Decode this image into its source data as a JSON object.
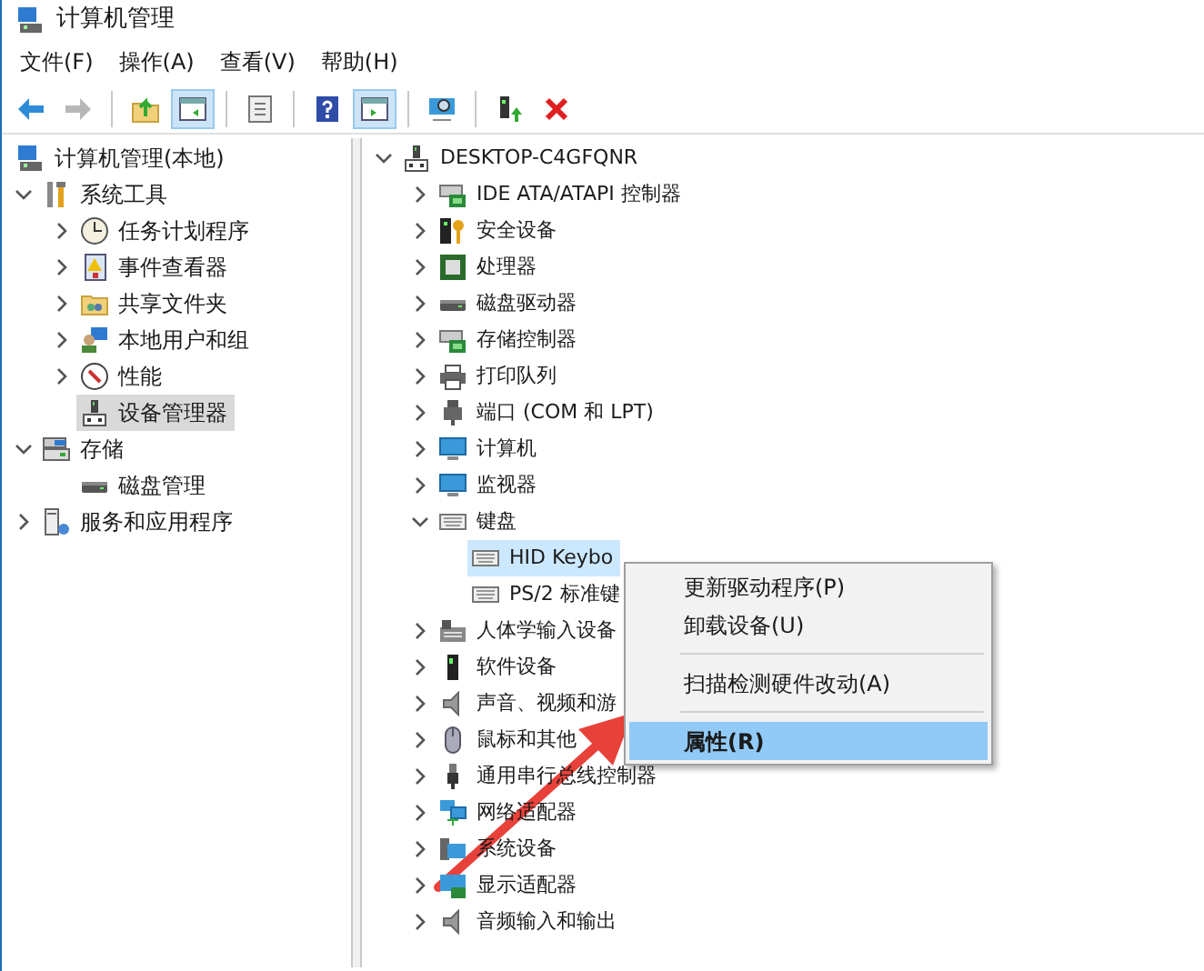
{
  "window": {
    "title": "计算机管理"
  },
  "menu_bar": [
    "文件(F)",
    "操作(A)",
    "查看(V)",
    "帮助(H)"
  ],
  "toolbar": [
    {
      "pressed": false,
      "disabled": false
    },
    {
      "pressed": false,
      "disabled": true
    },
    {
      "pressed": false,
      "disabled": false
    },
    {
      "pressed": true,
      "disabled": false
    },
    {
      "pressed": false,
      "disabled": false
    },
    {
      "pressed": false,
      "disabled": false
    },
    {
      "pressed": true,
      "disabled": false
    },
    {
      "pressed": false,
      "disabled": false
    },
    {
      "pressed": false,
      "disabled": false
    },
    {
      "pressed": false,
      "disabled": false
    }
  ],
  "console_tree": {
    "label": "计算机管理(本地)",
    "children": [
      {
        "label": "系统工具",
        "expanded": true,
        "selected": false,
        "children": [
          {
            "label": "任务计划程序",
            "expanded": false,
            "selected": false
          },
          {
            "label": "事件查看器",
            "expanded": false,
            "selected": false
          },
          {
            "label": "共享文件夹",
            "expanded": false,
            "selected": false
          },
          {
            "label": "本地用户和组",
            "expanded": false,
            "selected": false
          },
          {
            "label": "性能",
            "expanded": false,
            "selected": false
          },
          {
            "label": "设备管理器",
            "selected": true
          }
        ]
      },
      {
        "label": "存储",
        "expanded": true,
        "selected": false,
        "children": [
          {
            "label": "磁盘管理",
            "selected": false
          }
        ]
      },
      {
        "label": "服务和应用程序",
        "expanded": false,
        "selected": false
      }
    ]
  },
  "device_tree": {
    "label": "DESKTOP-C4GFQNR",
    "expanded": true,
    "children": [
      {
        "label": "IDE ATA/ATAPI 控制器",
        "expanded": false,
        "selected": false
      },
      {
        "label": "安全设备",
        "expanded": false,
        "selected": false
      },
      {
        "label": "处理器",
        "expanded": false,
        "selected": false
      },
      {
        "label": "磁盘驱动器",
        "expanded": false,
        "selected": false
      },
      {
        "label": "存储控制器",
        "expanded": false,
        "selected": false
      },
      {
        "label": "打印队列",
        "expanded": false,
        "selected": false
      },
      {
        "label": "端口 (COM 和 LPT)",
        "expanded": false,
        "selected": false
      },
      {
        "label": "计算机",
        "expanded": false,
        "selected": false
      },
      {
        "label": "监视器",
        "expanded": false,
        "selected": false
      },
      {
        "label": "键盘",
        "expanded": true,
        "selected": false,
        "children": [
          {
            "label": "HID Keybo",
            "selected": true
          },
          {
            "label": "PS/2 标准键",
            "selected": false
          }
        ]
      },
      {
        "label": "人体学输入设备",
        "expanded": false,
        "selected": false
      },
      {
        "label": "软件设备",
        "expanded": false,
        "selected": false
      },
      {
        "label": "声音、视频和游",
        "expanded": false,
        "selected": false
      },
      {
        "label": "鼠标和其他",
        "expanded": false,
        "selected": false
      },
      {
        "label": "通用串行总线控制器",
        "expanded": false,
        "selected": false
      },
      {
        "label": "网络适配器",
        "expanded": false,
        "selected": false
      },
      {
        "label": "系统设备",
        "expanded": false,
        "selected": false
      },
      {
        "label": "显示适配器",
        "expanded": false,
        "selected": false
      },
      {
        "label": "音频输入和输出",
        "expanded": false,
        "selected": false
      }
    ]
  },
  "context_menu": [
    {
      "kind": "item",
      "label": "更新驱动程序(P)",
      "selected": false,
      "default": false
    },
    {
      "kind": "item",
      "label": "卸载设备(U)",
      "selected": false,
      "default": false
    },
    {
      "kind": "separator"
    },
    {
      "kind": "item",
      "label": "扫描检测硬件改动(A)",
      "selected": false,
      "default": false
    },
    {
      "kind": "separator"
    },
    {
      "kind": "item",
      "label": "属性(R)",
      "selected": true,
      "default": true
    }
  ]
}
